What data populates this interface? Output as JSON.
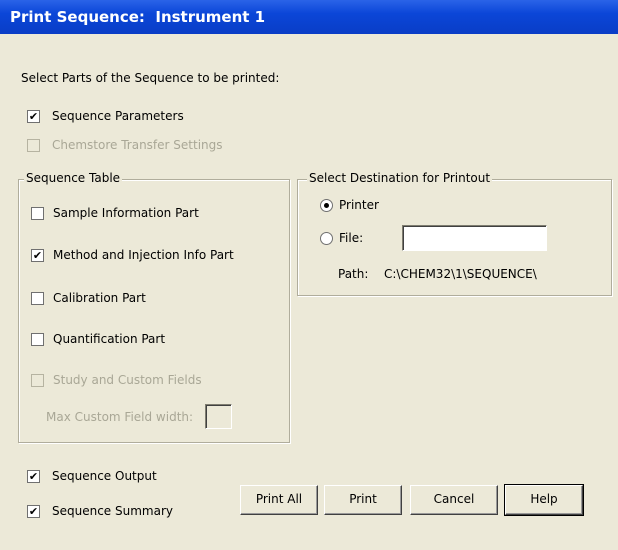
{
  "window": {
    "title": "Print Sequence:  Instrument 1"
  },
  "intro_label": "Select Parts of the Sequence to be printed:",
  "top_options": [
    {
      "label": "Sequence Parameters",
      "checked": true,
      "enabled": true
    },
    {
      "label": "Chemstore Transfer Settings",
      "checked": false,
      "enabled": false
    }
  ],
  "sequence_table": {
    "title": "Sequence Table",
    "items": [
      {
        "label": "Sample Information Part",
        "checked": false,
        "enabled": true
      },
      {
        "label": "Method and Injection Info Part",
        "checked": true,
        "enabled": true
      },
      {
        "label": "Calibration Part",
        "checked": false,
        "enabled": true
      },
      {
        "label": "Quantification Part",
        "checked": false,
        "enabled": true
      },
      {
        "label": "Study and Custom Fields",
        "checked": false,
        "enabled": false
      }
    ],
    "max_width_label": "Max Custom Field width:",
    "max_width_value": ""
  },
  "destination": {
    "title": "Select Destination for Printout",
    "printer_label": "Printer",
    "file_label": "File:",
    "selected": "Printer",
    "file_value": "",
    "path_label": "Path:",
    "path_value": "C:\\CHEM32\\1\\SEQUENCE\\"
  },
  "bottom_options": [
    {
      "label": "Sequence Output",
      "checked": true,
      "enabled": true
    },
    {
      "label": "Sequence Summary",
      "checked": true,
      "enabled": true
    }
  ],
  "buttons": {
    "print_all": "Print All",
    "print": "Print",
    "cancel": "Cancel",
    "help": "Help"
  },
  "check_glyph": "✔"
}
